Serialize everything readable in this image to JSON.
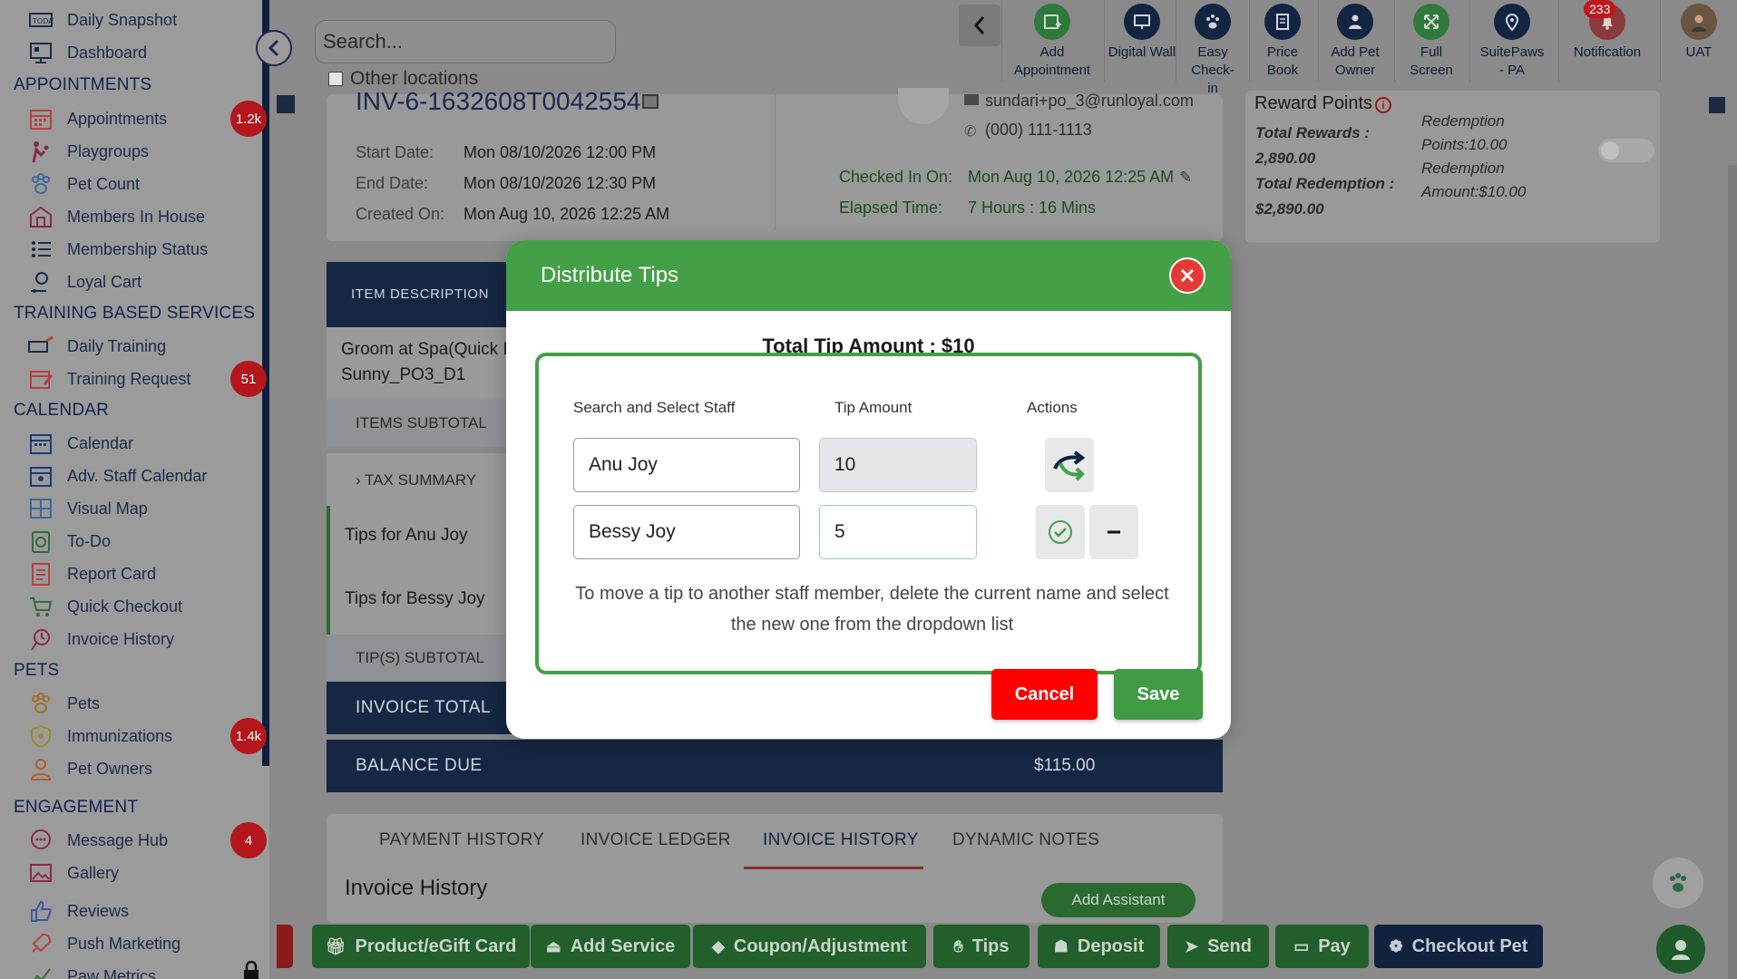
{
  "sidebar": {
    "top_items": [
      {
        "label": "Daily Snapshot",
        "icon": "today-icon"
      },
      {
        "label": "Dashboard",
        "icon": "dashboard-icon"
      }
    ],
    "sections": {
      "appointments": "APPOINTMENTS",
      "training": "TRAINING BASED SERVICES",
      "calendar": "CALENDAR",
      "pets": "PETS",
      "engagement": "ENGAGEMENT"
    },
    "appointments": [
      {
        "label": "Appointments",
        "badge": "1.2k"
      },
      {
        "label": "Playgroups"
      },
      {
        "label": "Pet Count"
      },
      {
        "label": "Members In House"
      },
      {
        "label": "Membership Status"
      },
      {
        "label": "Loyal Cart"
      }
    ],
    "training": [
      {
        "label": "Daily Training"
      },
      {
        "label": "Training Request",
        "badge": "51"
      }
    ],
    "calendar": [
      {
        "label": "Calendar"
      },
      {
        "label": "Adv. Staff Calendar"
      },
      {
        "label": "Visual Map"
      },
      {
        "label": "To-Do"
      },
      {
        "label": "Report Card"
      },
      {
        "label": "Quick Checkout"
      },
      {
        "label": "Invoice History"
      }
    ],
    "pets": [
      {
        "label": "Pets"
      },
      {
        "label": "Immunizations",
        "badge": "1.4k"
      },
      {
        "label": "Pet Owners"
      }
    ],
    "engagement": [
      {
        "label": "Message Hub",
        "badge": "4"
      },
      {
        "label": "Gallery"
      },
      {
        "label": "Reviews"
      },
      {
        "label": "Push Marketing"
      },
      {
        "label": "Paw Metrics"
      }
    ]
  },
  "topbar": {
    "search_placeholder": "Search...",
    "other_locations": "Other locations",
    "items": [
      {
        "label": "Add Appointment",
        "icon": "calendar-add-icon"
      },
      {
        "label": "Digital Wall",
        "icon": "monitor-icon"
      },
      {
        "label": "Easy Check-in",
        "icon": "paw-icon"
      },
      {
        "label": "Price Book",
        "icon": "document-icon"
      },
      {
        "label": "Add Pet Owner",
        "icon": "person-add-icon"
      },
      {
        "label": "Full Screen",
        "icon": "expand-icon"
      },
      {
        "label": "SuitePaws - PA",
        "icon": "pin-icon"
      },
      {
        "label": "Notification",
        "icon": "bell-icon"
      },
      {
        "label": "UAT",
        "icon": "avatar"
      }
    ],
    "notification_count": "233"
  },
  "invoice": {
    "number": "INV-6-1632608T0042554",
    "start_label": "Start Date:",
    "start_value": "Mon 08/10/2026 12:00 PM",
    "end_label": "End Date:",
    "end_value": "Mon 08/10/2026 12:30 PM",
    "created_label": "Created On:",
    "created_value": "Mon Aug 10, 2026 12:25 AM",
    "email": "sundari+po_3@runloyal.com",
    "phone": "(000) 111-1113",
    "checked_in_label": "Checked In On:",
    "checked_in_value": "Mon Aug 10, 2026 12:25 AM",
    "elapsed_label": "Elapsed Time:",
    "elapsed_value": "7 Hours : 16 Mins"
  },
  "rewards": {
    "title": "Reward Points",
    "total_rewards_label": "Total Rewards :",
    "total_rewards_value": "2,890.00",
    "total_redemption_label": "Total Redemption :",
    "total_redemption_value": "$2,890.00",
    "redemption_points": "Redemption Points:10.00",
    "redemption_amount": "Redemption Amount:$10.00"
  },
  "table": {
    "header": "ITEM DESCRIPTION",
    "item_line1": "Groom at Spa(Quick I",
    "item_line2": "Sunny_PO3_D1",
    "items_subtotal": "ITEMS SUBTOTAL",
    "tax_summary": "TAX SUMMARY",
    "tip1": "Tips for Anu Joy",
    "tip2": "Tips for Bessy Joy",
    "tips_subtotal": "TIP(S) SUBTOTAL",
    "invoice_total": "INVOICE TOTAL",
    "balance_due": "BALANCE DUE",
    "balance_due_value": "$115.00"
  },
  "tabs": [
    "PAYMENT HISTORY",
    "INVOICE LEDGER",
    "INVOICE HISTORY",
    "DYNAMIC NOTES"
  ],
  "active_tab": "INVOICE HISTORY",
  "invoice_history_title": "Invoice History",
  "add_assistant": "Add Assistant",
  "actions": [
    {
      "label": "Product/eGift Card",
      "icon": "gift-icon"
    },
    {
      "label": "Add Service",
      "icon": "service-icon"
    },
    {
      "label": "Coupon/Adjustment",
      "icon": "tag-icon"
    },
    {
      "label": "Tips",
      "icon": "tips-icon"
    },
    {
      "label": "Deposit",
      "icon": "deposit-icon"
    },
    {
      "label": "Send",
      "icon": "send-icon"
    },
    {
      "label": "Pay",
      "icon": "card-icon"
    },
    {
      "label": "Checkout Pet",
      "icon": "paw-icon"
    }
  ],
  "modal": {
    "title": "Distribute Tips",
    "total_tip": "Total Tip Amount : $10",
    "col_staff": "Search and Select Staff",
    "col_tip": "Tip Amount",
    "col_actions": "Actions",
    "rows": [
      {
        "staff": "Anu Joy",
        "tip": "10"
      },
      {
        "staff": "Bessy Joy",
        "tip": "5"
      }
    ],
    "hint": "To move a tip to another staff member, delete the current name and select the new one from the dropdown list",
    "cancel": "Cancel",
    "save": "Save"
  },
  "colors": {
    "modal_header": "#43a047",
    "close_button": "#e53935",
    "cancel": "#ff0000",
    "save": "#3f9b44",
    "navy": "#152742",
    "badge": "#b3161b"
  }
}
